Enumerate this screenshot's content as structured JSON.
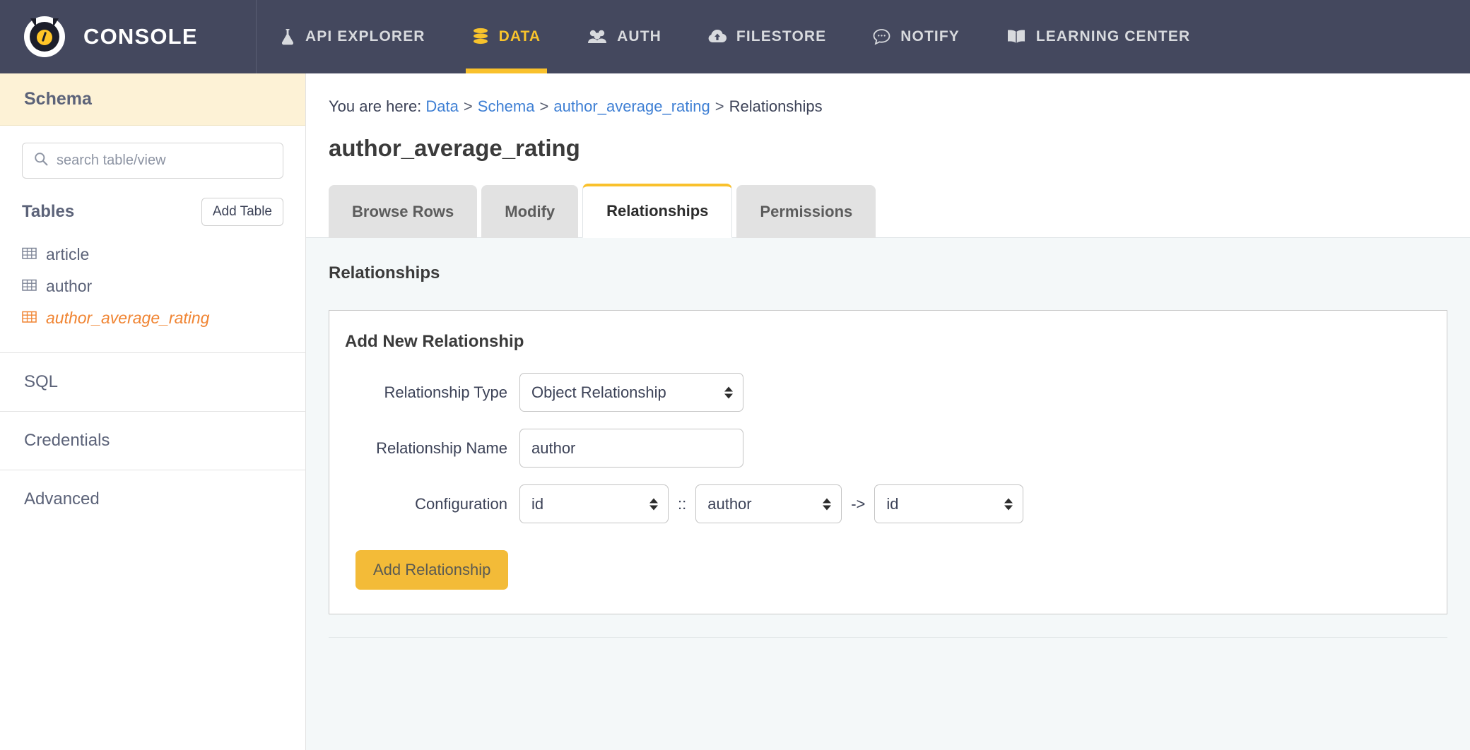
{
  "topnav": {
    "brand": "CONSOLE",
    "brand_icon": "hasura-owl-logo",
    "items": [
      {
        "label": "API EXPLORER",
        "icon": "flask-icon",
        "active": false
      },
      {
        "label": "DATA",
        "icon": "database-icon",
        "active": true
      },
      {
        "label": "AUTH",
        "icon": "users-icon",
        "active": false
      },
      {
        "label": "FILESTORE",
        "icon": "cloud-upload-icon",
        "active": false
      },
      {
        "label": "NOTIFY",
        "icon": "chat-bubble-icon",
        "active": false
      },
      {
        "label": "LEARNING CENTER",
        "icon": "book-icon",
        "active": false
      }
    ]
  },
  "sidebar": {
    "header": "Schema",
    "search": {
      "value": "",
      "placeholder": "search table/view",
      "icon": "search-icon"
    },
    "tables_label": "Tables",
    "add_table_label": "Add Table",
    "tables": [
      {
        "name": "article",
        "selected": false
      },
      {
        "name": "author",
        "selected": false
      },
      {
        "name": "author_average_rating",
        "selected": true
      }
    ],
    "sections": [
      {
        "label": "SQL"
      },
      {
        "label": "Credentials"
      },
      {
        "label": "Advanced"
      }
    ]
  },
  "main": {
    "breadcrumb": {
      "prefix": "You are here:",
      "items": [
        "Data",
        "Schema",
        "author_average_rating",
        "Relationships"
      ],
      "separator": ">"
    },
    "page_title": "author_average_rating",
    "tabs": [
      {
        "label": "Browse Rows",
        "active": false
      },
      {
        "label": "Modify",
        "active": false
      },
      {
        "label": "Relationships",
        "active": true
      },
      {
        "label": "Permissions",
        "active": false
      }
    ],
    "section_title": "Relationships",
    "panel": {
      "title": "Add New Relationship",
      "fields": {
        "type_label": "Relationship Type",
        "type_value": "Object Relationship",
        "name_label": "Relationship Name",
        "name_value": "author",
        "name_placeholder": "",
        "config_label": "Configuration",
        "config_source_column": "id",
        "config_joiner": "::",
        "config_target_table": "author",
        "config_arrow": "->",
        "config_target_column": "id"
      },
      "submit_label": "Add Relationship"
    }
  },
  "colors": {
    "navbar_bg": "#44485e",
    "accent_yellow": "#f9c12c",
    "selected_table": "#f08432",
    "link_blue": "#3e7fd4",
    "schema_header_bg": "#fdf2d6",
    "content_bg": "#f4f8f9",
    "button_yellow": "#f3bb38"
  }
}
